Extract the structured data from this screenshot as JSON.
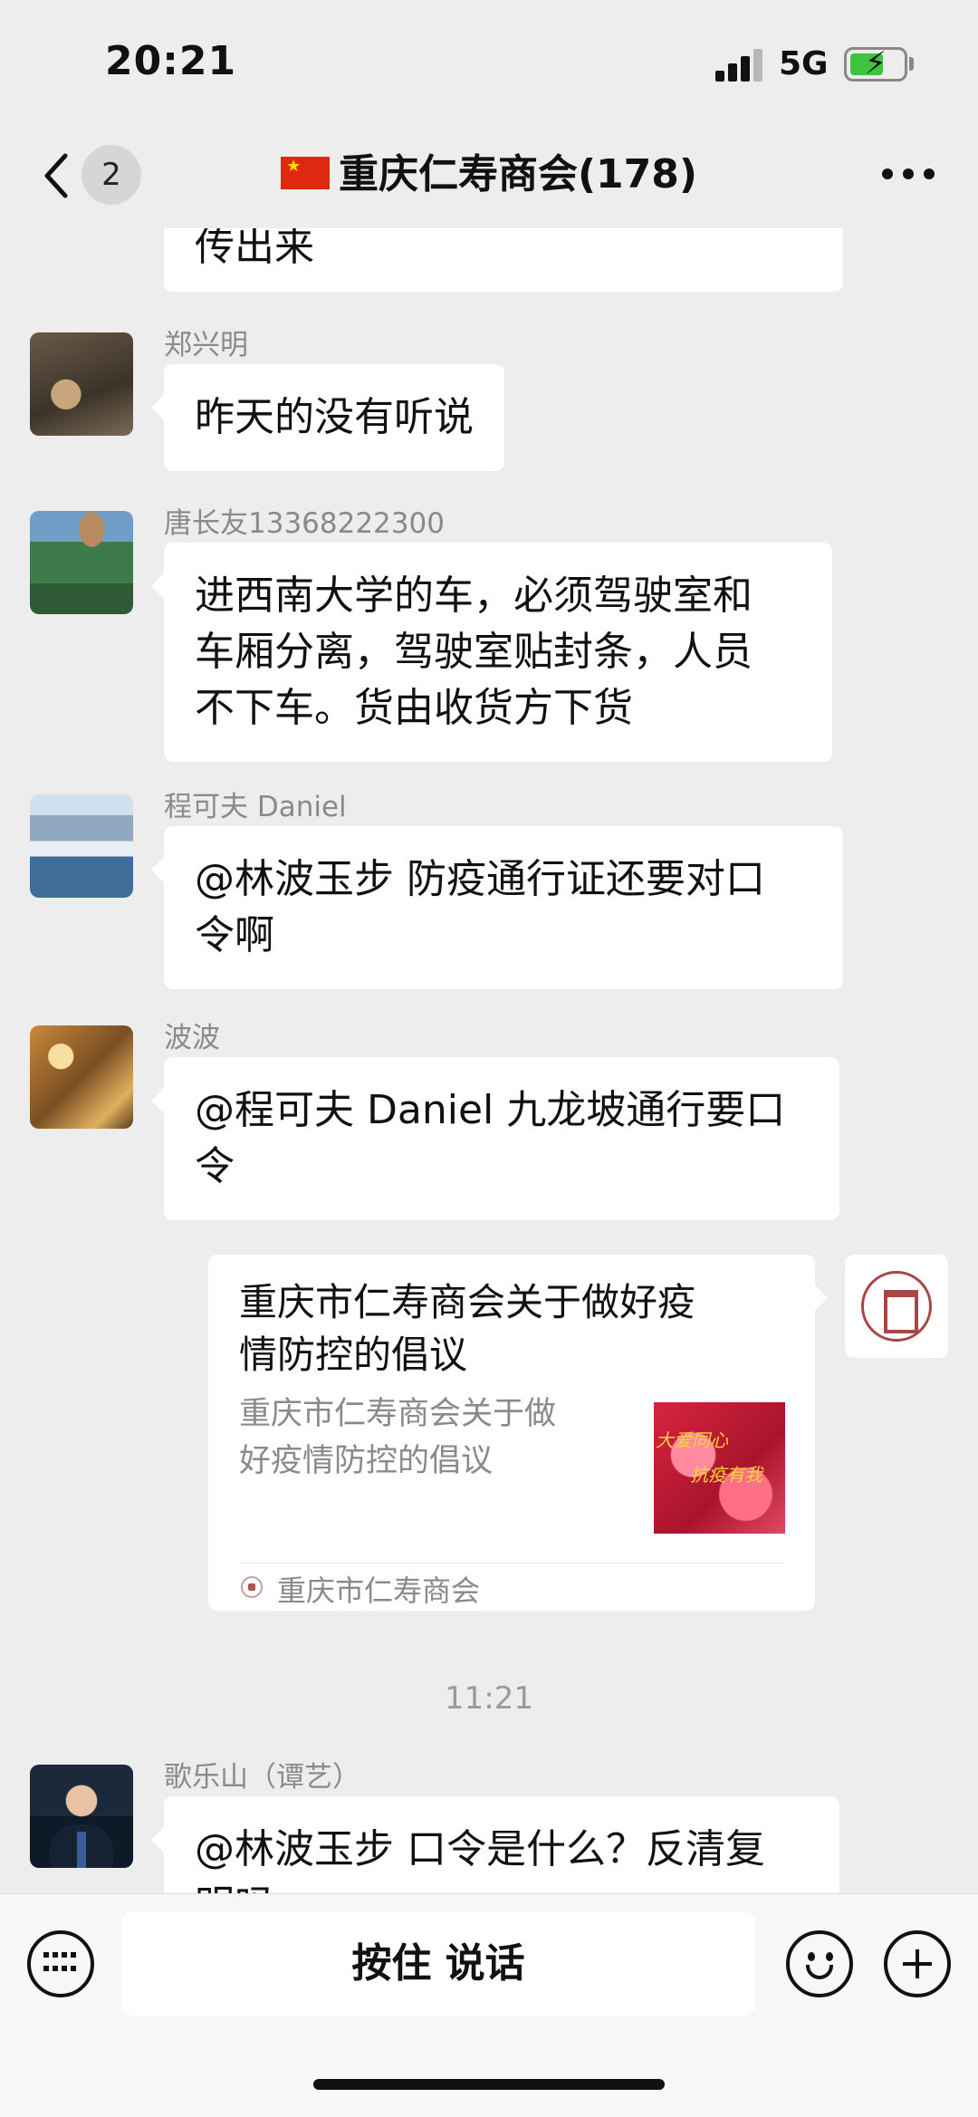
{
  "status_bar": {
    "time": "20:21",
    "network": "5G",
    "battery_color": "#3ec33e"
  },
  "nav": {
    "back_badge": "2",
    "title": "重庆仁寿商会(178)",
    "flag": "China flag"
  },
  "messages": [
    {
      "type": "text",
      "sender": "",
      "text": "传出来"
    },
    {
      "type": "text",
      "sender": "郑兴明",
      "text": "昨天的没有听说",
      "avatar": "fish-avatar"
    },
    {
      "type": "text",
      "sender": "唐长友13368222300",
      "lines": [
        "进西南大学的车，必须驾驶室和",
        "车厢分离，驾驶室贴封条，人员",
        "不下车。货由收货方下货"
      ],
      "avatar": "landscape-avatar"
    },
    {
      "type": "text",
      "sender": "程可夫 Daniel",
      "lines": [
        "@林波玉步 防疫通行证还要对口",
        "令啊"
      ],
      "avatar": "snow-mountain-avatar"
    },
    {
      "type": "text",
      "sender": "波波",
      "lines": [
        "@程可夫 Daniel 九龙坡通行要口",
        "令"
      ],
      "avatar": "market-avatar"
    },
    {
      "type": "link_card",
      "title_lines": [
        "重庆市仁寿商会关于做好疫",
        "情防控的倡议"
      ],
      "desc_lines": [
        "重庆市仁寿商会关于做",
        "好疫情防控的倡议"
      ],
      "thumb_text": [
        "大爱同心",
        "抗疫有我"
      ],
      "source": "重庆市仁寿商会"
    },
    {
      "type": "timestamp",
      "text": "11:21"
    },
    {
      "type": "text",
      "sender": "歌乐山（谭艺）",
      "lines": [
        "@林波玉步 口令是什么？反清复",
        "明吗"
      ],
      "avatar": "man-in-suit-avatar"
    }
  ],
  "input_bar": {
    "voice_label": "按住 说话"
  }
}
